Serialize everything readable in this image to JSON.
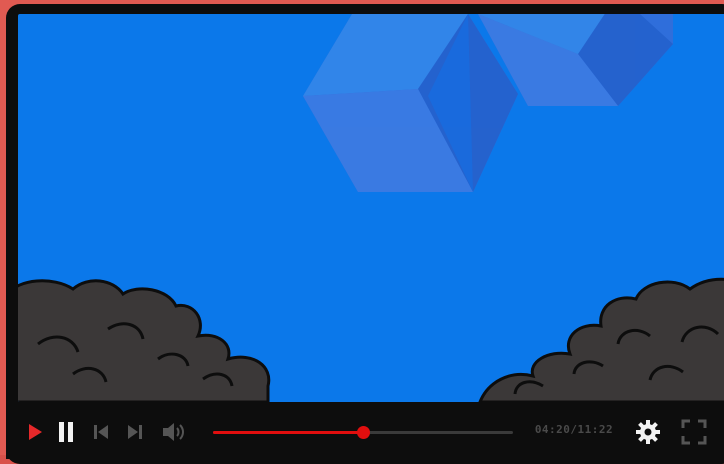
{
  "player": {
    "time_display": "04:20/11:22",
    "progress": 0.5
  },
  "icons": {
    "play": "play-icon",
    "pause": "pause-icon",
    "previous": "skip-previous-icon",
    "next": "skip-next-icon",
    "volume": "volume-icon",
    "settings": "gear-icon",
    "fullscreen": "fullscreen-icon"
  },
  "colors": {
    "frame": "#e15a52",
    "player_body": "#0d0d0d",
    "screen_sky": "#0b78ea",
    "progress_accent": "#e10e0e",
    "play_button": "#e6282a",
    "icon_light": "#f2f2f2",
    "icon_dim": "#555555",
    "time_text": "#4a4a4a"
  }
}
